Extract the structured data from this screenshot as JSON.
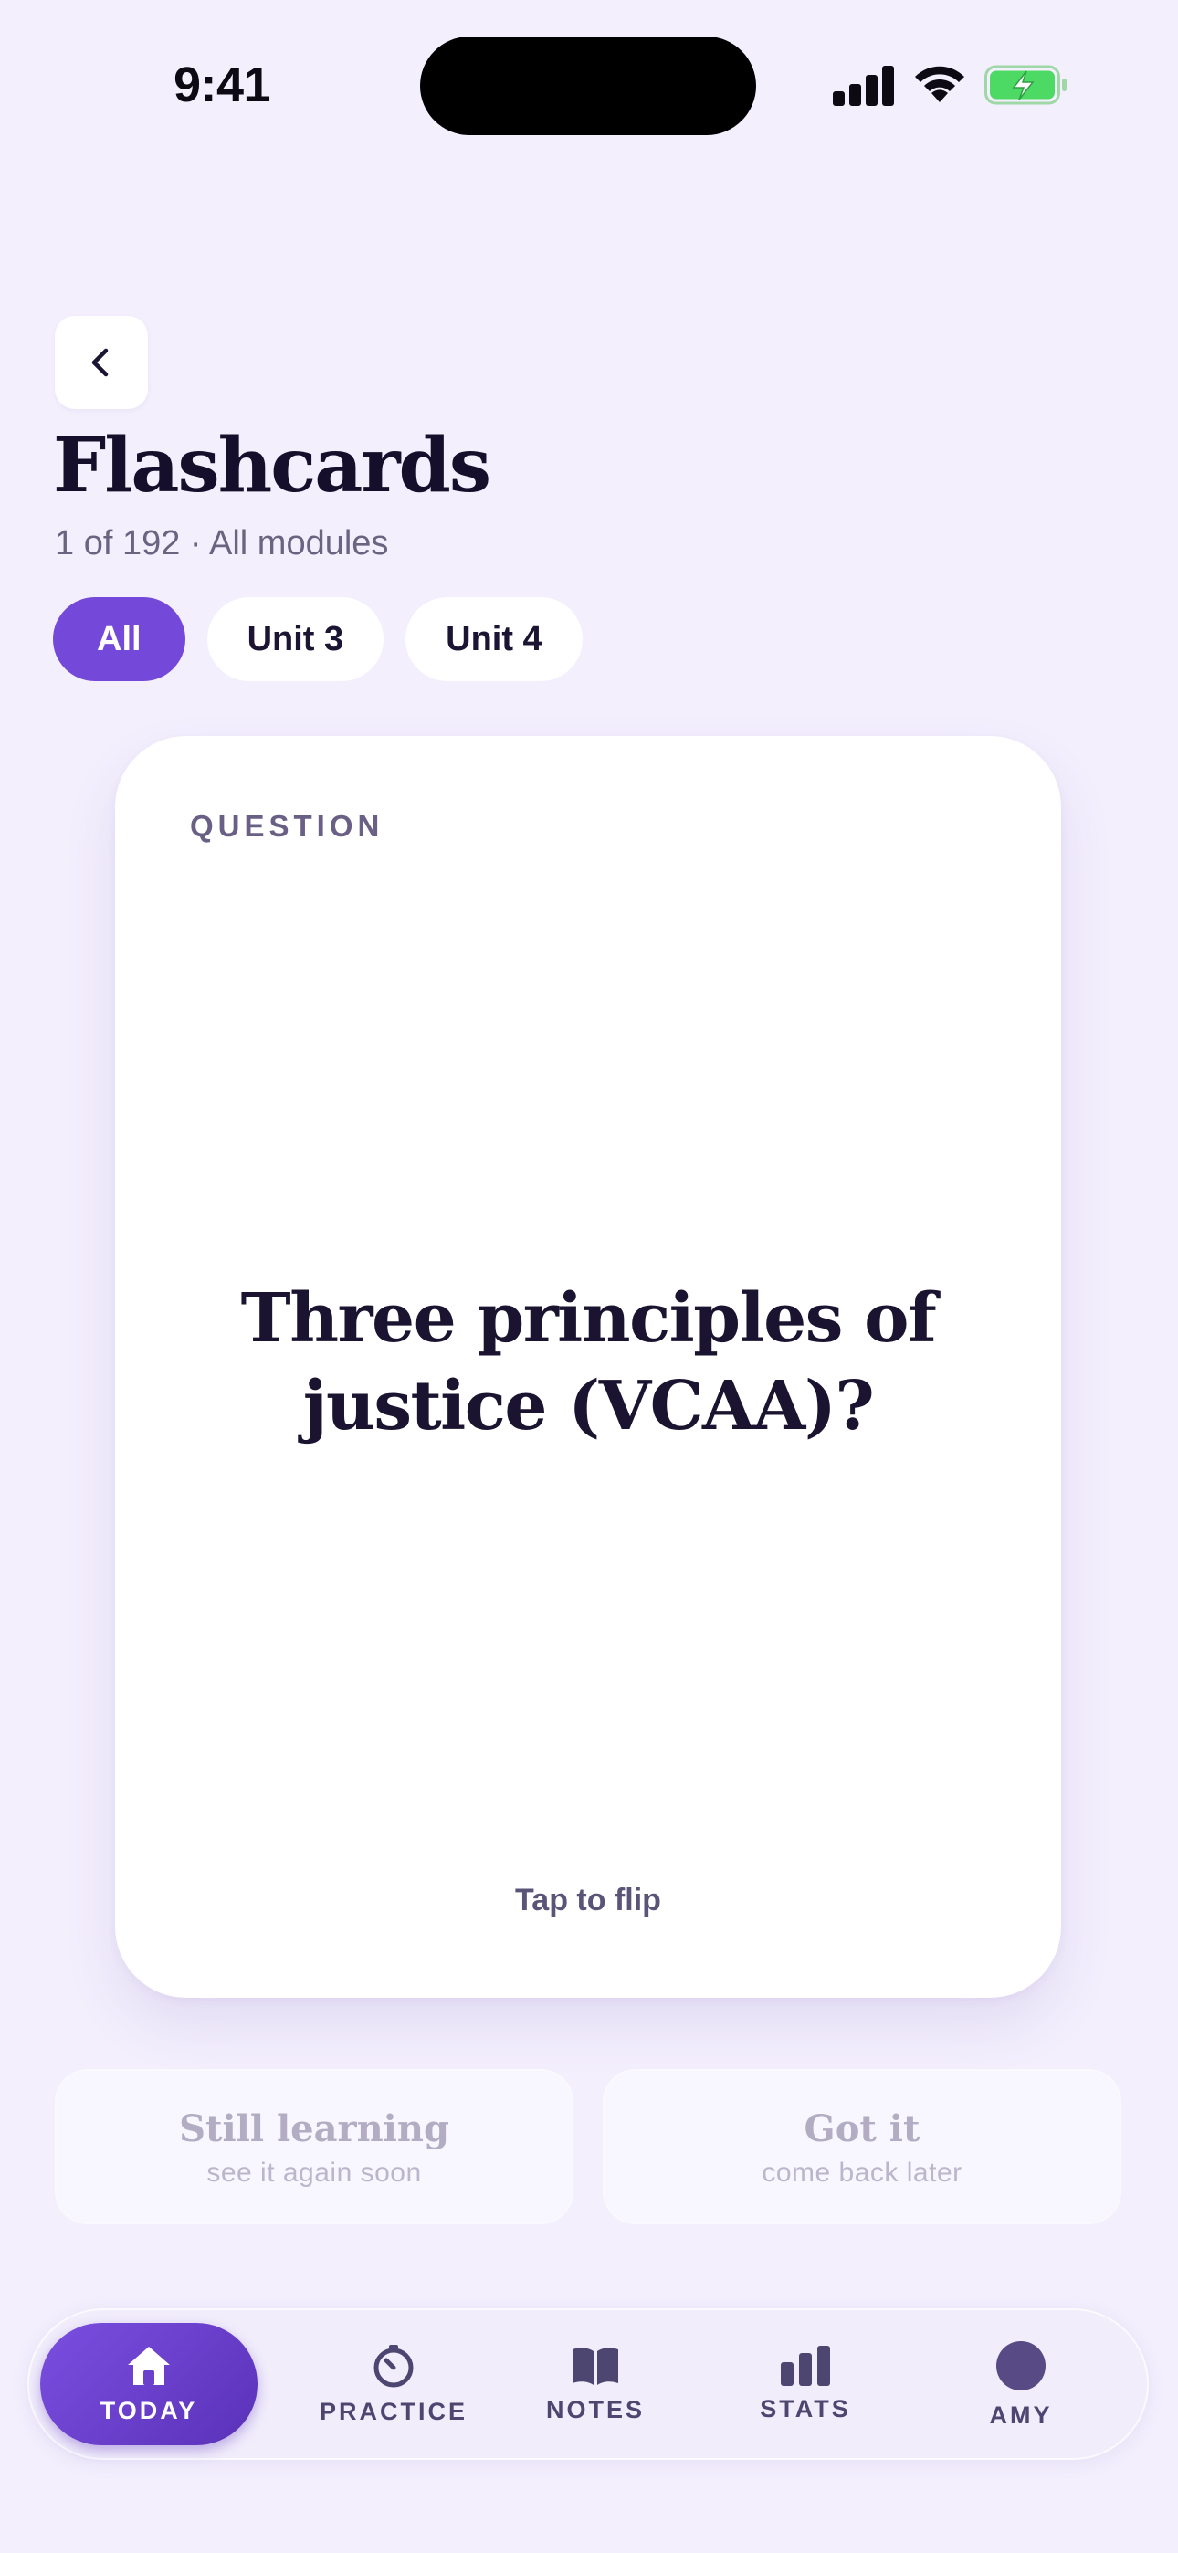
{
  "status_bar": {
    "time": "9:41"
  },
  "header": {
    "title": "Flashcards",
    "subtitle": "1 of 192 · All modules"
  },
  "filters": [
    {
      "label": "All",
      "active": true
    },
    {
      "label": "Unit 3",
      "active": false
    },
    {
      "label": "Unit 4",
      "active": false
    }
  ],
  "card": {
    "label": "QUESTION",
    "question": "Three principles of justice (VCAA)?",
    "hint": "Tap to flip"
  },
  "answers": {
    "still_learning": {
      "title": "Still learning",
      "subtitle": "see it again soon"
    },
    "got_it": {
      "title": "Got it",
      "subtitle": "come back later"
    }
  },
  "tabs": [
    {
      "label": "TODAY",
      "icon": "home-icon",
      "active": true
    },
    {
      "label": "PRACTICE",
      "icon": "timer-icon",
      "active": false
    },
    {
      "label": "NOTES",
      "icon": "book-icon",
      "active": false
    },
    {
      "label": "STATS",
      "icon": "bar-chart-icon",
      "active": false
    },
    {
      "label": "AMY",
      "icon": "avatar",
      "active": false
    }
  ],
  "colors": {
    "accent": "#7448d8",
    "background": "#f3effd",
    "battery": "#4cd964"
  }
}
